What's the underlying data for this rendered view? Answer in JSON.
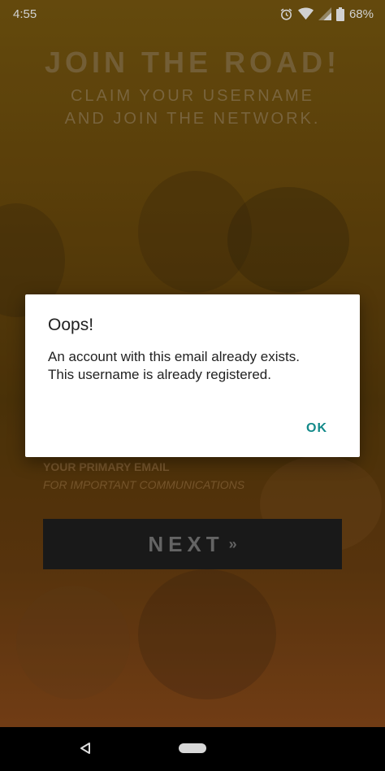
{
  "status_bar": {
    "time": "4:55",
    "battery": "68%",
    "icons": [
      "alarm-icon",
      "wifi-icon",
      "signal-icon",
      "battery-icon"
    ]
  },
  "header": {
    "title": "JOIN THE ROAD!",
    "subtitle_line1": "CLAIM YOUR USERNAME",
    "subtitle_line2": "AND JOIN THE NETWORK."
  },
  "form": {
    "email_label": "YOUR PRIMARY EMAIL",
    "email_hint": "FOR IMPORTANT COMMUNICATIONS",
    "next_label": "NEXT",
    "next_chevron": "»"
  },
  "dialog": {
    "title": "Oops!",
    "message_line1": "An account with this email already exists.",
    "message_line2": "This username is already registered.",
    "ok_label": "OK"
  },
  "colors": {
    "accent": "#138a8a",
    "background": "#6b4a0c",
    "button": "#1f1f1f"
  }
}
